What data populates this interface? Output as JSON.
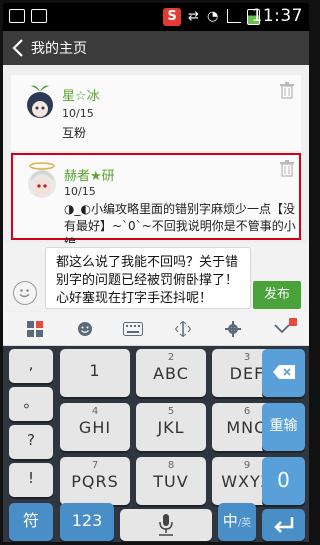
{
  "status_bar": {
    "time": "11:37"
  },
  "titlebar": {
    "title": "我的主页"
  },
  "messages": [
    {
      "name": "星☆冰",
      "date": "10/15",
      "text": "互粉"
    },
    {
      "name": "赫者★研",
      "date": "10/15",
      "text": "◑_◐小编攻略里面的错别字麻烦少一点【没有最好】~`0`~不回我说明你是不管事的小编"
    }
  ],
  "composer": {
    "text": "都这么说了我能不回吗？关于错别字的问题已经被罚俯卧撑了！心好塞现在打字手还抖呢！",
    "send_label": "发布"
  },
  "keyboard": {
    "side_keys": [
      ",",
      "。",
      "?",
      "!"
    ],
    "rows": [
      [
        {
          "num": "1",
          "lbl": ""
        },
        {
          "num": "",
          "lbl": "ABC"
        },
        {
          "num": "",
          "lbl": "DEF"
        }
      ],
      [
        {
          "num": "",
          "lbl": "GHI"
        },
        {
          "num": "",
          "lbl": "JKL"
        },
        {
          "num": "",
          "lbl": "MNO"
        }
      ],
      [
        {
          "num": "",
          "lbl": "PQRS"
        },
        {
          "num": "",
          "lbl": "TUV"
        },
        {
          "num": "",
          "lbl": "WXYZ"
        }
      ]
    ],
    "digits": [
      "2",
      "3",
      "4",
      "5",
      "6",
      "7",
      "8",
      "9"
    ],
    "right_keys": [
      "重输",
      "0"
    ],
    "bottom": {
      "symbol": "符",
      "num": "123",
      "lang_main": "中",
      "lang_alt": "/英"
    }
  }
}
